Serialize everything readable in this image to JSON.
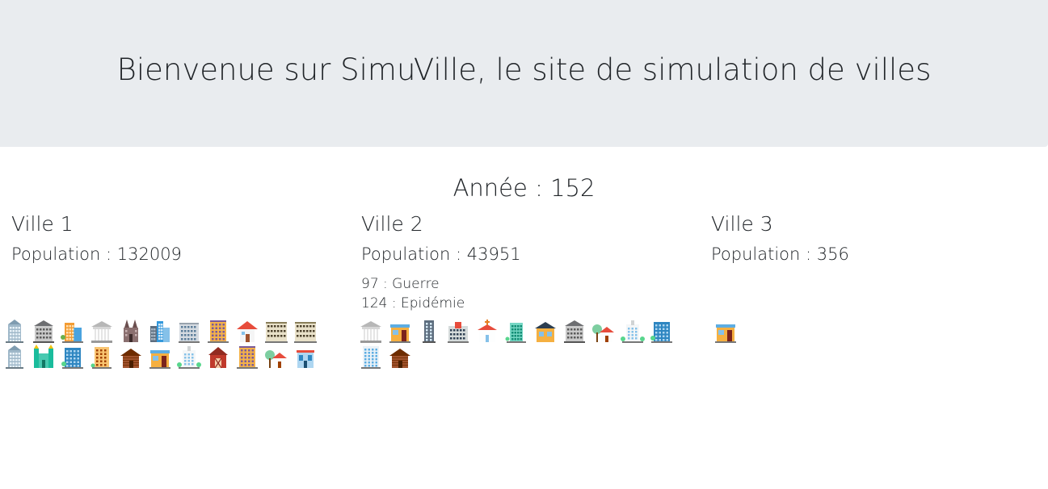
{
  "header": {
    "title": "Bienvenue sur SimuVille, le site de simulation de villes"
  },
  "year": {
    "label": "Année : 152"
  },
  "cities": [
    {
      "name": "Ville 1",
      "population_label": "Population : 132009",
      "events": [],
      "buildings": [
        "tower-blue",
        "museum",
        "office-orange",
        "temple",
        "church",
        "skyscrapers",
        "apartments",
        "hotel",
        "house-red",
        "palace",
        "palace",
        "tower-blue",
        "castle",
        "office-teal",
        "apartments-orange",
        "cabin",
        "shop",
        "hospital",
        "barn",
        "hotel",
        "house-tree",
        "shop-blue"
      ]
    },
    {
      "name": "Ville 2",
      "population_label": "Population : 43951",
      "events": [
        "97 : Guerre",
        "124 : Epidémie"
      ],
      "buildings": [
        "temple",
        "shop",
        "tower-gray",
        "school",
        "chapel",
        "tower-teal",
        "house-orange",
        "museum",
        "house-tree",
        "hospital",
        "office-teal",
        "apartments-white",
        "cabin"
      ]
    },
    {
      "name": "Ville 3",
      "population_label": "Population : 356",
      "events": [],
      "buildings": [
        "shop"
      ]
    }
  ],
  "colors": {
    "hero_bg": "#e9ecef",
    "text": "#212529"
  }
}
